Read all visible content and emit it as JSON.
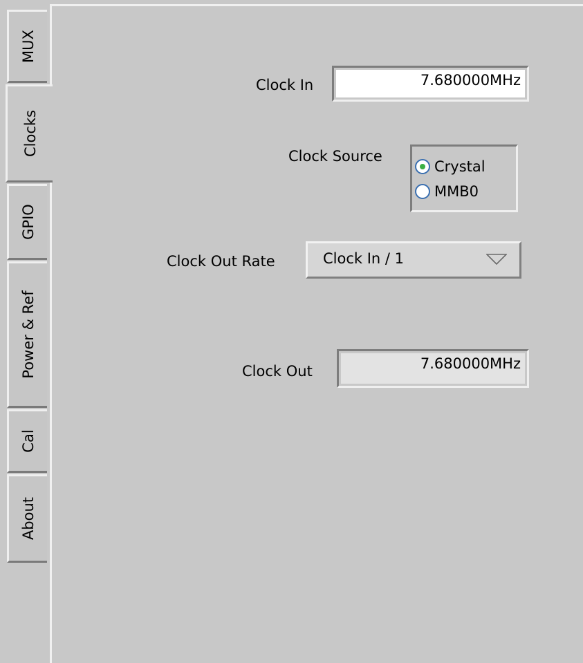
{
  "tabs": [
    {
      "label": "MUX",
      "active": false
    },
    {
      "label": "Clocks",
      "active": true
    },
    {
      "label": "GPIO",
      "active": false
    },
    {
      "label": "Power & Ref",
      "active": false
    },
    {
      "label": "Cal",
      "active": false
    },
    {
      "label": "About",
      "active": false
    }
  ],
  "clocks": {
    "clock_in_label": "Clock In",
    "clock_in_value": "7.680000MHz",
    "clock_source_label": "Clock Source",
    "clock_source_options": [
      {
        "label": "Crystal",
        "selected": true
      },
      {
        "label": "MMB0",
        "selected": false
      }
    ],
    "clock_out_rate_label": "Clock Out Rate",
    "clock_out_rate_value": "Clock In / 1",
    "clock_out_label": "Clock Out",
    "clock_out_value": "7.680000MHz"
  },
  "colors": {
    "background": "#c8c8c8",
    "input_field": "#ffffff",
    "output_field": "#e3e3e3",
    "radio_border": "#3a6fb0",
    "radio_selected_dot": "#3cb043"
  },
  "icons": {
    "dropdown_arrow": "triangle-down-outline-icon"
  }
}
